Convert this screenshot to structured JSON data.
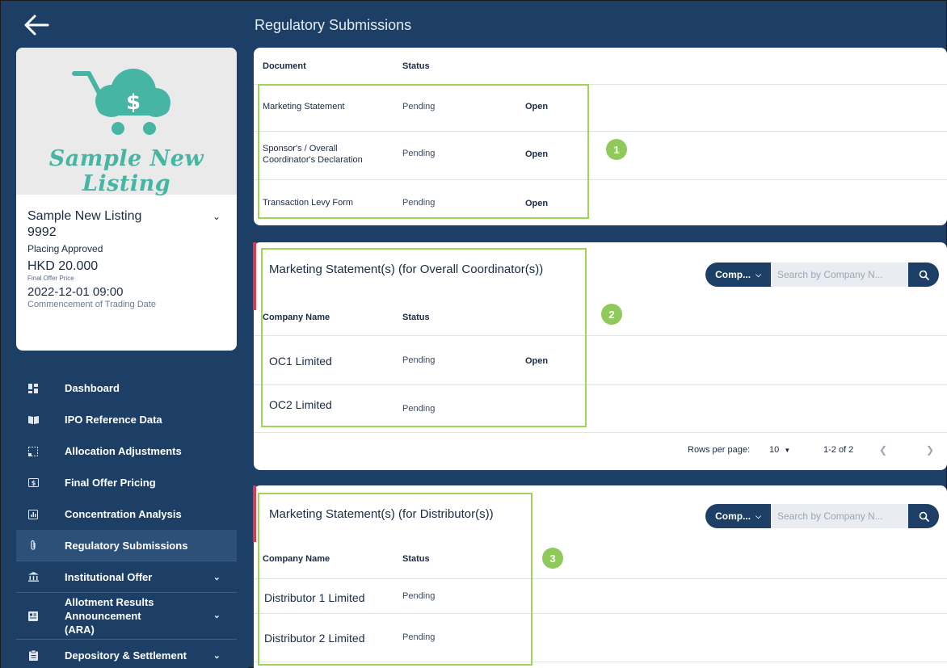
{
  "page": {
    "title": "Regulatory Submissions"
  },
  "profile": {
    "logo_text": "Sample New Listing",
    "listing_name": "Sample New Listing",
    "stock_code": "9992",
    "status": "Placing Approved",
    "price": "HKD 20.000",
    "price_label": "Final Offer Price",
    "trading_date": "2022-12-01 09:00",
    "trading_date_label": "Commencement of Trading Date"
  },
  "nav": {
    "items": [
      {
        "label": "Dashboard",
        "icon": "dashboard-icon"
      },
      {
        "label": "IPO Reference Data",
        "icon": "book-icon"
      },
      {
        "label": "Allocation Adjustments",
        "icon": "adjust-icon"
      },
      {
        "label": "Final Offer Pricing",
        "icon": "dollar-icon"
      },
      {
        "label": "Concentration Analysis",
        "icon": "chart-icon"
      },
      {
        "label": "Regulatory Submissions",
        "icon": "paperclip-icon"
      },
      {
        "label": "Institutional Offer",
        "icon": "bank-icon"
      },
      {
        "label": "Allotment Results Announcement (ARA)",
        "icon": "newspaper-icon"
      },
      {
        "label": "Depository & Settlement",
        "icon": "clipboard-icon"
      }
    ]
  },
  "documents": {
    "headers": {
      "document": "Document",
      "status": "Status"
    },
    "rows": [
      {
        "document": "Marketing Statement",
        "status": "Pending",
        "action": "Open"
      },
      {
        "document": "Sponsor's / Overall Coordinator's Declaration",
        "status": "Pending",
        "action": "Open"
      },
      {
        "document": "Transaction Levy Form",
        "status": "Pending",
        "action": "Open"
      }
    ]
  },
  "oc_section": {
    "title": "Marketing Statement(s) (for Overall Coordinator(s))",
    "filter_label": "Comp...",
    "search_placeholder": "Search by Company N...",
    "headers": {
      "company": "Company Name",
      "status": "Status"
    },
    "rows": [
      {
        "company": "OC1 Limited",
        "status": "Pending",
        "action": "Open"
      },
      {
        "company": "OC2 Limited",
        "status": "Pending",
        "action": ""
      }
    ],
    "pagination": {
      "rows_label": "Rows per page:",
      "rows_value": "10",
      "range": "1-2 of 2"
    }
  },
  "dist_section": {
    "title": "Marketing Statement(s) (for Distributor(s))",
    "filter_label": "Comp...",
    "search_placeholder": "Search by Company N...",
    "headers": {
      "company": "Company Name",
      "status": "Status"
    },
    "rows": [
      {
        "company": "Distributor 1 Limited",
        "status": "Pending"
      },
      {
        "company": "Distributor 2 Limited",
        "status": "Pending"
      }
    ]
  },
  "callouts": [
    "1",
    "2",
    "3"
  ],
  "colors": {
    "navy": "#1d3f66",
    "highlight_green": "#9fd35a",
    "badge_green": "#8ec95a",
    "accent_red": "#e03a4a",
    "logo_teal": "#46b5a4"
  }
}
